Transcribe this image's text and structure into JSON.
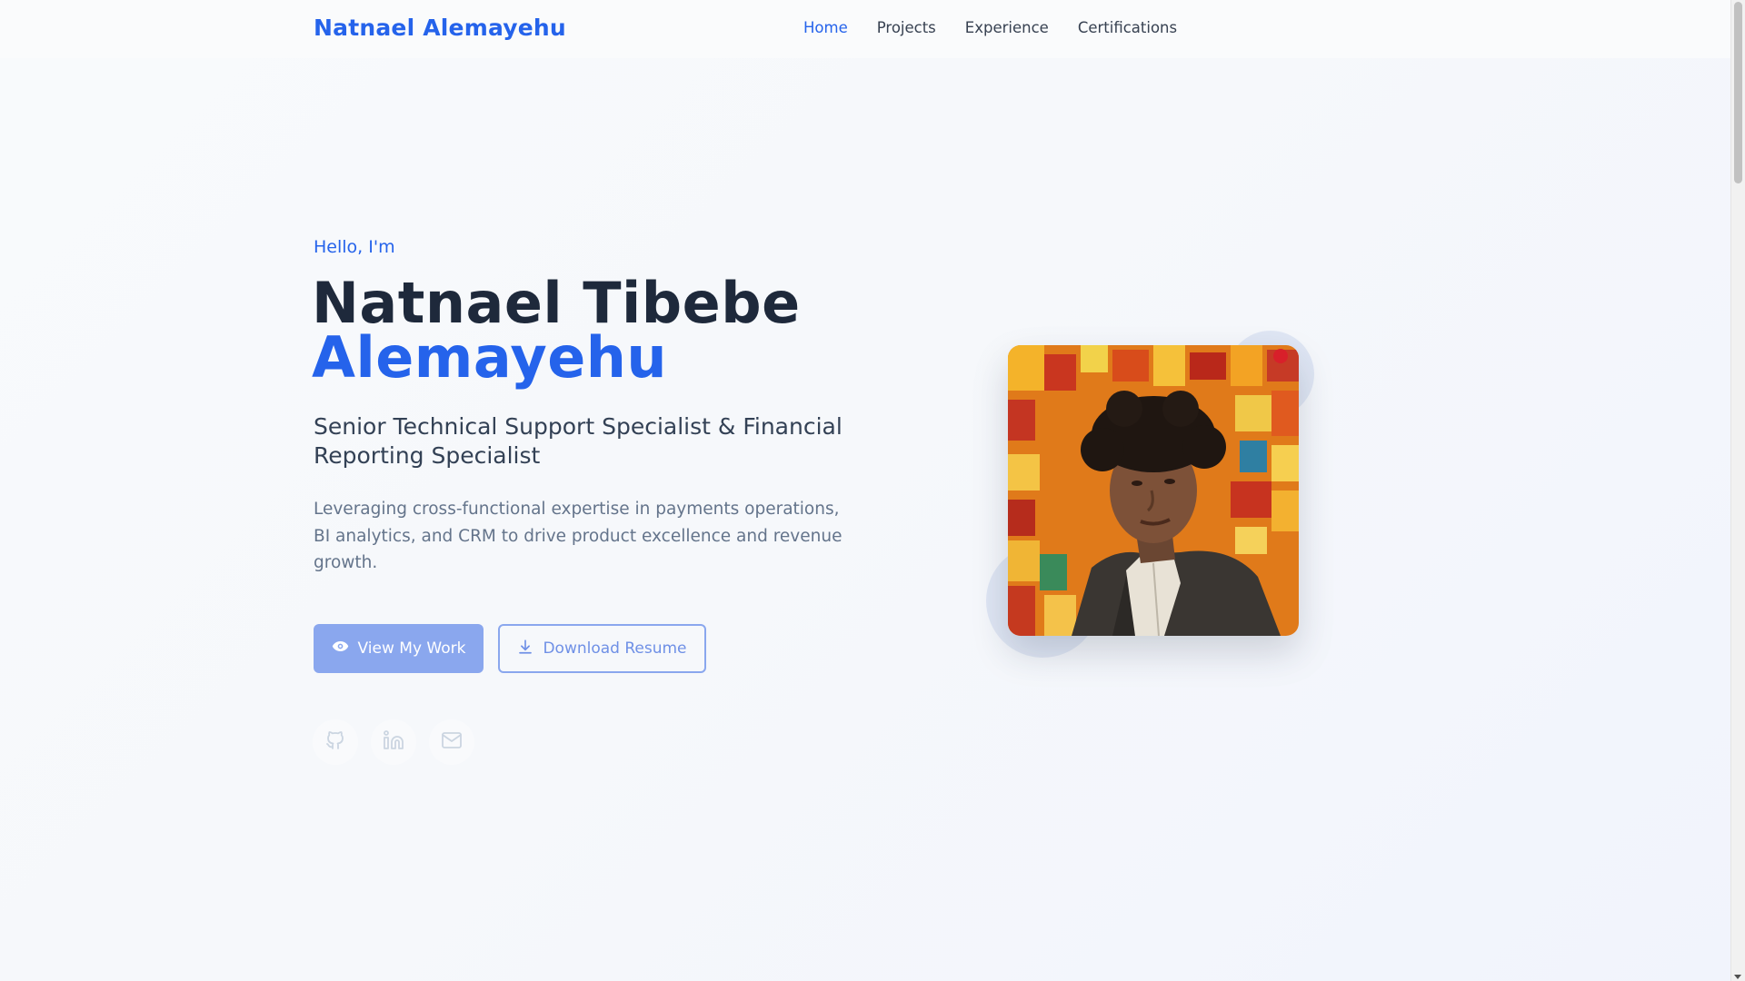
{
  "nav": {
    "brand": "Natnael Alemayehu",
    "links": [
      "Home",
      "Projects",
      "Experience",
      "Certifications"
    ],
    "active": "Home"
  },
  "hero": {
    "greeting": "Hello, I'm",
    "name_first": "Natnael Tibebe",
    "name_last": "Alemayehu",
    "role": "Senior Technical Support Specialist & Financial Reporting Specialist",
    "description": "Leveraging cross-functional expertise in payments operations, BI analytics, and CRM to drive product excellence and revenue growth.",
    "primary_button": "View My Work",
    "secondary_button": "Download Resume"
  },
  "social": {
    "icons": [
      "github-icon",
      "linkedin-icon",
      "mail-icon"
    ]
  },
  "colors": {
    "accent": "#2563eb",
    "heading": "#1e293b",
    "text_muted": "#64748b",
    "button_fill": "#8aa7ee"
  }
}
